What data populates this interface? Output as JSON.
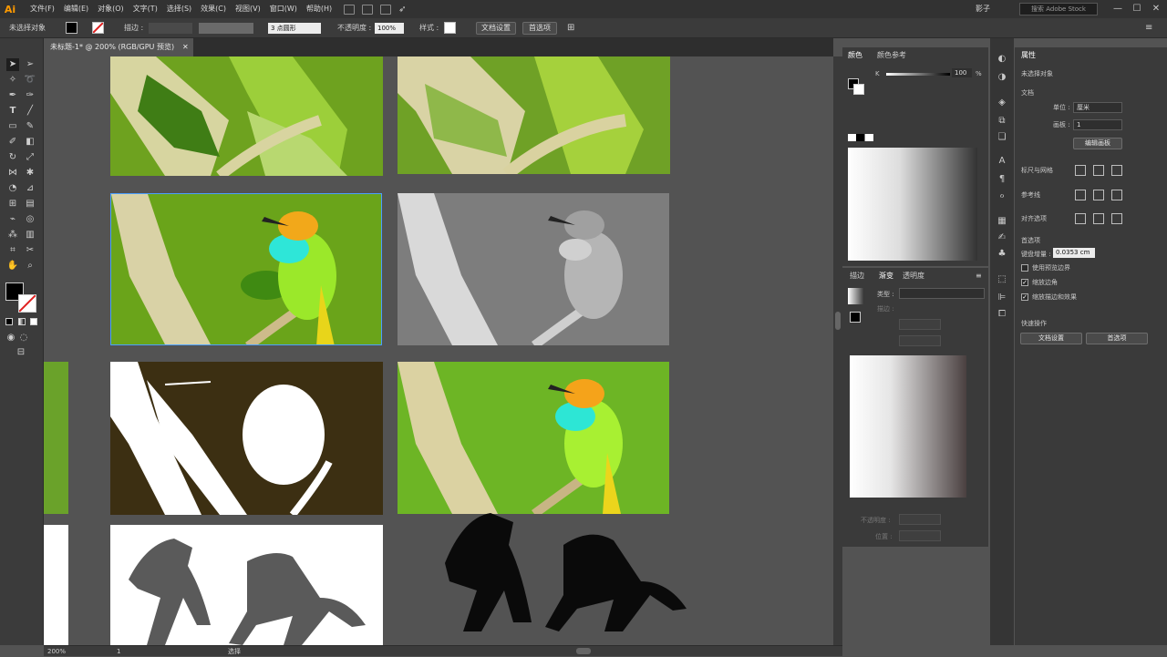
{
  "menubar": {
    "logo": "Ai",
    "items": [
      "文件(F)",
      "编辑(E)",
      "对象(O)",
      "文字(T)",
      "选择(S)",
      "效果(C)",
      "视图(V)",
      "窗口(W)",
      "帮助(H)"
    ],
    "workspace": "影子",
    "search_placeholder": "搜索 Adobe Stock",
    "window_controls": [
      "—",
      "☐",
      "✕"
    ]
  },
  "control_bar": {
    "selection_label": "未选择对象",
    "stroke_label": "描边 :",
    "brush_value": "3 点圆形",
    "opacity_label": "不透明度 :",
    "opacity_value": "100%",
    "style_label": "样式 :",
    "doc_setup_label": "文档设置",
    "prefs_label": "首选项"
  },
  "document": {
    "tab_title": "未标题-1* @ 200% (RGB/GPU 预览)",
    "tab_close": "✕"
  },
  "status_bar": {
    "zoom": "200%",
    "page": "1",
    "mode": "选择"
  },
  "color_panel": {
    "tabs": [
      "颜色",
      "颜色参考"
    ],
    "channel_label": "K",
    "channel_value": "100",
    "channel_unit": "%"
  },
  "gradient_panel": {
    "tabs": [
      "描边",
      "渐变",
      "透明度"
    ],
    "type_label": "类型 :",
    "stroke_label": "描边 :",
    "opacity_label": "不透明度 :",
    "position_label": "位置 :"
  },
  "properties_panel": {
    "title": "属性",
    "selection": "未选择对象",
    "doc_section": "文档",
    "units_label": "单位 :",
    "units_value": "厘米",
    "artboard_label": "画板 :",
    "artboard_value": "1",
    "edit_artboards": "编辑画板",
    "rulers_label": "标尺与网格",
    "guides_label": "参考线",
    "align_label": "对齐选项",
    "prefs_section": "首选项",
    "nudge_label": "键盘增量 :",
    "nudge_value": "0.0353 cm",
    "opt1": "使用预览边界",
    "opt2": "缩放边角",
    "opt3": "缩放描边和效果",
    "quick_actions": "快速操作",
    "doc_setup": "文档设置",
    "preferences": "首选项"
  },
  "colors": {
    "accent": "#ff9a00",
    "panel_bg": "#3a3a3a",
    "canvas_bg": "#535353",
    "art_dark_brown": "#3c2f12"
  }
}
